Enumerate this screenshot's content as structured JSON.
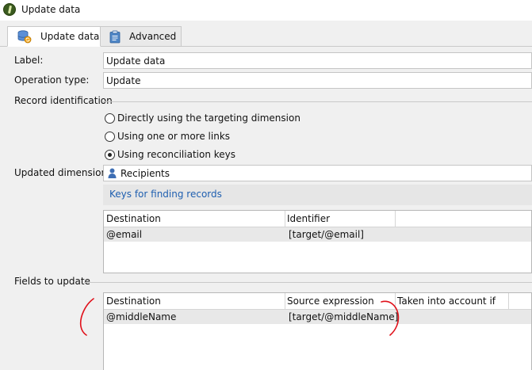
{
  "window": {
    "title": "Update data"
  },
  "tabs": [
    {
      "label": "Update data",
      "icon": "database-update-icon",
      "active": true
    },
    {
      "label": "Advanced",
      "icon": "clipboard-icon",
      "active": false
    }
  ],
  "form": {
    "label_caption": "Label:",
    "label_value": "Update data",
    "operation_type_caption": "Operation type:",
    "operation_type_value": "Update",
    "record_identification_caption": "Record identification",
    "radio_options": [
      {
        "label": "Directly using the targeting dimension",
        "checked": false
      },
      {
        "label": "Using one or more links",
        "checked": false
      },
      {
        "label": "Using reconciliation keys",
        "checked": true
      }
    ],
    "updated_dimension_caption": "Updated dimension:",
    "updated_dimension_value": "Recipients",
    "keys_link": "Keys for finding records"
  },
  "keys_table": {
    "columns": [
      "Destination",
      "Identifier"
    ],
    "rows": [
      [
        "@email",
        "[target/@email]"
      ]
    ]
  },
  "fields_to_update": {
    "caption": "Fields to update",
    "columns": [
      "Destination",
      "Source expression",
      "Taken into account if"
    ],
    "rows": [
      [
        "@middleName",
        "[target/@middleName]",
        ""
      ]
    ]
  },
  "colors": {
    "link": "#1f5fb0",
    "annotation": "#e0101a",
    "panel": "#f0f0f0",
    "selected_row": "#e8e8e8"
  }
}
